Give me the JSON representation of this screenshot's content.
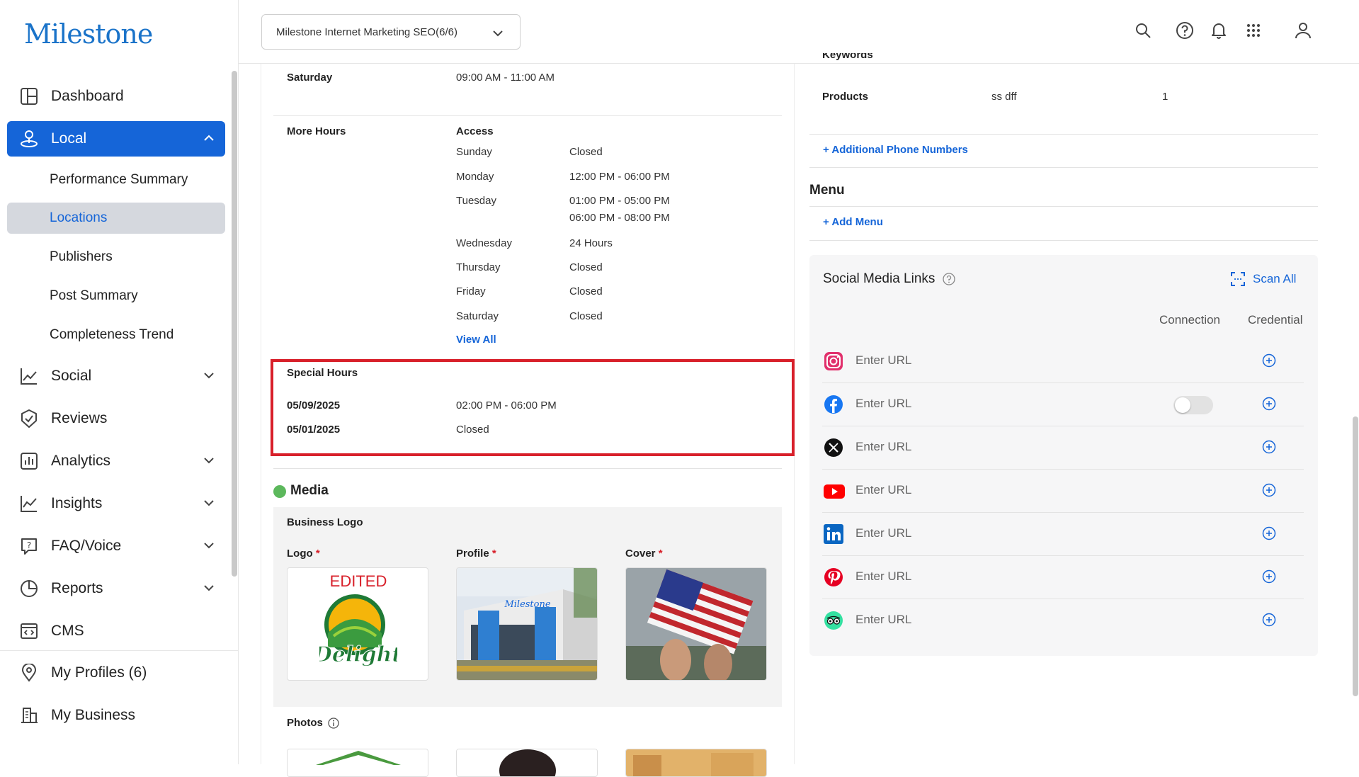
{
  "brand": {
    "logo_text": "Milestone",
    "accent": "#1565d8",
    "highlight": "#d8202a"
  },
  "sidebar": {
    "items": [
      {
        "label": "Dashboard",
        "icon": "dashboard-icon"
      },
      {
        "label": "Local",
        "icon": "local-pin-icon",
        "active": true,
        "expanded": true
      },
      {
        "label": "Social",
        "icon": "social-chart-icon"
      },
      {
        "label": "Reviews",
        "icon": "reviews-check-icon"
      },
      {
        "label": "Analytics",
        "icon": "analytics-bar-icon"
      },
      {
        "label": "Insights",
        "icon": "insights-line-icon"
      },
      {
        "label": "FAQ/Voice",
        "icon": "faq-bubble-icon"
      },
      {
        "label": "Reports",
        "icon": "reports-pie-icon"
      },
      {
        "label": "CMS",
        "icon": "cms-code-icon"
      },
      {
        "label": "My Profiles (6)",
        "icon": "location-pin-icon"
      },
      {
        "label": "My Business",
        "icon": "building-icon"
      }
    ],
    "local_sub": [
      {
        "label": "Performance Summary"
      },
      {
        "label": "Locations",
        "active": true
      },
      {
        "label": "Publishers"
      },
      {
        "label": "Post Summary"
      },
      {
        "label": "Completeness Trend"
      }
    ]
  },
  "topbar": {
    "account_select": "Milestone Internet Marketing SEO(6/6)",
    "icons": [
      "search-icon",
      "help-icon",
      "bell-icon",
      "apps-grid-icon",
      "user-icon"
    ]
  },
  "hours": {
    "saturday_label": "Saturday",
    "saturday_value": "09:00 AM - 11:00 AM",
    "more_hours_label": "More Hours",
    "access_label": "Access",
    "access_days": [
      {
        "day": "Sunday",
        "hours": "Closed"
      },
      {
        "day": "Monday",
        "hours": "12:00 PM - 06:00 PM"
      },
      {
        "day": "Tuesday",
        "hours": "01:00 PM - 05:00 PM",
        "hours2": "06:00 PM - 08:00 PM"
      },
      {
        "day": "Wednesday",
        "hours": "24 Hours"
      },
      {
        "day": "Thursday",
        "hours": "Closed"
      },
      {
        "day": "Friday",
        "hours": "Closed"
      },
      {
        "day": "Saturday",
        "hours": "Closed"
      }
    ],
    "view_all": "View All",
    "special_hours_label": "Special Hours",
    "special": [
      {
        "date": "05/09/2025",
        "hours": "02:00 PM - 06:00 PM"
      },
      {
        "date": "05/01/2025",
        "hours": "Closed"
      }
    ]
  },
  "media": {
    "title": "Media",
    "status_color": "#5cb85c",
    "business_logo_label": "Business Logo",
    "logo_label": "Logo",
    "profile_label": "Profile",
    "cover_label": "Cover",
    "required_mark": "*",
    "logo_overlay_text": "EDITED",
    "logo_brand_text": "Delight",
    "profile_sign_text": "Milestone",
    "photos_label": "Photos"
  },
  "right": {
    "keywords_label": "Keywords",
    "products_label": "Products",
    "products_value": "ss dff",
    "products_count": "1",
    "additional_phone": "Additional Phone Numbers",
    "menu_title": "Menu",
    "add_menu": "Add Menu",
    "social": {
      "title": "Social Media Links",
      "scan_all": "Scan All",
      "col_connection": "Connection",
      "col_credential": "Credential",
      "rows": [
        {
          "network": "instagram",
          "placeholder": "Enter URL"
        },
        {
          "network": "facebook",
          "placeholder": "Enter URL",
          "connection": false
        },
        {
          "network": "x",
          "placeholder": "Enter URL"
        },
        {
          "network": "youtube",
          "placeholder": "Enter URL"
        },
        {
          "network": "linkedin",
          "placeholder": "Enter URL"
        },
        {
          "network": "pinterest",
          "placeholder": "Enter URL"
        },
        {
          "network": "tripadvisor",
          "placeholder": "Enter URL"
        }
      ]
    }
  }
}
